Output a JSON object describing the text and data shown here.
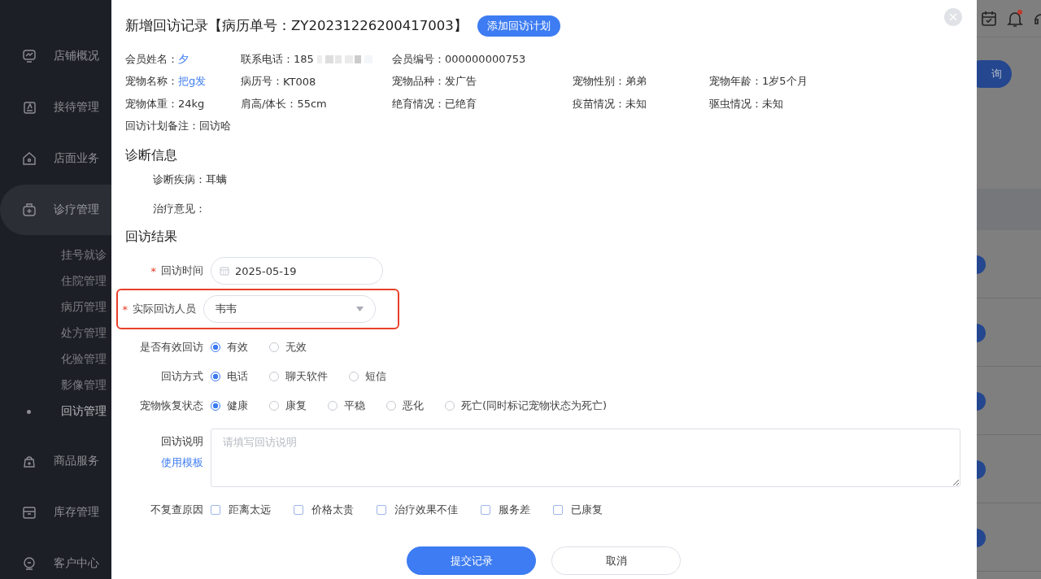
{
  "sidebar": {
    "items": [
      {
        "label": "店铺概况",
        "selected": false
      },
      {
        "label": "接待管理",
        "selected": false
      },
      {
        "label": "店面业务",
        "selected": false
      },
      {
        "label": "诊疗管理",
        "selected": true,
        "children": [
          {
            "label": "挂号就诊",
            "selected": false
          },
          {
            "label": "住院管理",
            "selected": false
          },
          {
            "label": "病历管理",
            "selected": false
          },
          {
            "label": "处方管理",
            "selected": false
          },
          {
            "label": "化验管理",
            "selected": false
          },
          {
            "label": "影像管理",
            "selected": false
          },
          {
            "label": "回访管理",
            "selected": true
          }
        ]
      },
      {
        "label": "商品服务",
        "selected": false
      },
      {
        "label": "库存管理",
        "selected": false
      },
      {
        "label": "客户中心",
        "selected": false
      }
    ]
  },
  "background": {
    "search_button": "询",
    "notification_dot": true
  },
  "modal": {
    "title": "新增回访记录【病历单号：ZY20231226200417003】",
    "action_button": "添加回访计划",
    "info_rows": [
      [
        {
          "label": "会员姓名：",
          "value": "夕",
          "kind": "link"
        },
        {
          "label": "联系电话：",
          "value": "185",
          "kind": "masked"
        },
        {
          "label": "会员编号：",
          "value": "000000000753",
          "kind": "plain"
        }
      ],
      [
        {
          "label": "宠物名称：",
          "value": "把g发",
          "kind": "link"
        },
        {
          "label": "病历号：",
          "value": "KT008",
          "kind": "plain"
        },
        {
          "label": "宠物品种：",
          "value": "发广告",
          "kind": "plain"
        },
        {
          "label": "宠物性别：",
          "value": "弟弟",
          "kind": "plain"
        },
        {
          "label": "宠物年龄：",
          "value": "1岁5个月",
          "kind": "plain"
        }
      ],
      [
        {
          "label": "宠物体重：",
          "value": "24kg",
          "kind": "plain"
        },
        {
          "label": "肩高/体长：",
          "value": "55cm",
          "kind": "plain"
        },
        {
          "label": "绝育情况：",
          "value": "已绝育",
          "kind": "plain"
        },
        {
          "label": "疫苗情况：",
          "value": "未知",
          "kind": "plain"
        },
        {
          "label": "驱虫情况：",
          "value": "未知",
          "kind": "plain"
        }
      ],
      [
        {
          "label": "回访计划备注：",
          "value": "回访哈",
          "kind": "plain"
        }
      ]
    ],
    "diagnosis": {
      "title": "诊断信息",
      "fields": [
        {
          "label": "诊断疾病：",
          "value": "耳螨"
        },
        {
          "label": "治疗意见："
        }
      ]
    },
    "result": {
      "title": "回访结果",
      "fields": [
        {
          "kind": "date",
          "label": "回访时间",
          "required_mark": "*",
          "value": "2025-05-19",
          "highlighted": false
        },
        {
          "kind": "select",
          "label": "实际回访人员",
          "required_mark": "*",
          "value": "韦韦",
          "highlighted": true
        },
        {
          "kind": "radio",
          "label": "是否有效回访",
          "options": [
            {
              "label": "有效",
              "selected": true
            },
            {
              "label": "无效",
              "selected": false
            }
          ]
        },
        {
          "kind": "radio",
          "label": "回访方式",
          "options": [
            {
              "label": "电话",
              "selected": true
            },
            {
              "label": "聊天软件",
              "selected": false
            },
            {
              "label": "短信",
              "selected": false
            }
          ]
        },
        {
          "kind": "radio",
          "label": "宠物恢复状态",
          "options": [
            {
              "label": "健康",
              "selected": true
            },
            {
              "label": "康复",
              "selected": false
            },
            {
              "label": "平稳",
              "selected": false
            },
            {
              "label": "恶化",
              "selected": false
            },
            {
              "label": "死亡(同时标记宠物状态为死亡)",
              "selected": false
            }
          ]
        },
        {
          "kind": "textarea",
          "label": "回访说明",
          "link": "使用模板",
          "placeholder": "请填写回访说明"
        },
        {
          "kind": "checkbox",
          "label": "不复查原因",
          "options": [
            {
              "label": "距离太远",
              "checked": false
            },
            {
              "label": "价格太贵",
              "checked": false
            },
            {
              "label": "治疗效果不佳",
              "checked": false
            },
            {
              "label": "服务差",
              "checked": false
            },
            {
              "label": "已康复",
              "checked": false
            }
          ]
        }
      ]
    },
    "buttons": [
      {
        "label": "提交记录",
        "kind": "primary"
      },
      {
        "label": "取消",
        "kind": "default"
      }
    ]
  }
}
